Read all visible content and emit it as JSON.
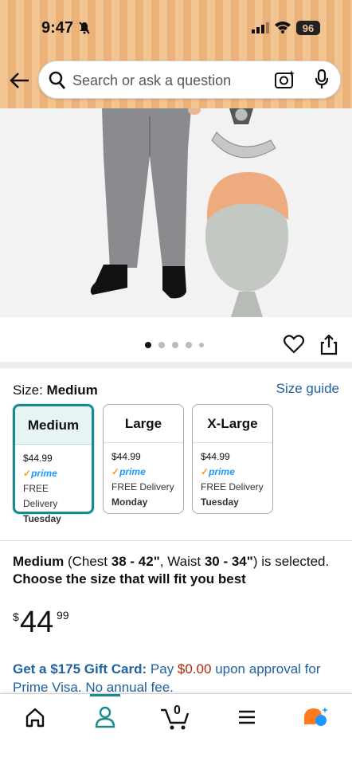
{
  "status": {
    "time": "9:47",
    "battery": "96"
  },
  "search": {
    "placeholder": "Search or ask a question"
  },
  "gallery": {
    "dot_count": 5,
    "active_index": 0
  },
  "size": {
    "label": "Size:",
    "selected": "Medium",
    "guide_link": "Size guide",
    "options": [
      {
        "name": "Medium",
        "price": "$44.99",
        "prime": "prime",
        "delivery": "FREE Delivery",
        "day": "Tuesday"
      },
      {
        "name": "Large",
        "price": "$44.99",
        "prime": "prime",
        "delivery": "FREE Delivery",
        "day": "Monday"
      },
      {
        "name": "X-Large",
        "price": "$44.99",
        "prime": "prime",
        "delivery": "FREE Delivery",
        "day": "Tuesday"
      }
    ]
  },
  "selection_info": {
    "size": "Medium",
    "chest_prefix": " (Chest ",
    "chest": "38 - 42\"",
    "waist_prefix": ", Waist ",
    "waist": "30 - 34\"",
    "suffix": ") is selected.",
    "advice": "Choose the size that will fit you best"
  },
  "price": {
    "symbol": "$",
    "whole": "44",
    "fraction": "99"
  },
  "gift_card": {
    "bold": "Get a $175 Gift Card:",
    "pay": " Pay ",
    "amount": "$0.00",
    "rest": " upon approval for Prime Visa. No annual fee."
  },
  "bottom_nav": {
    "cart_count": "0",
    "items": [
      "home-icon",
      "account-icon",
      "cart-icon",
      "menu-icon",
      "rufus-icon"
    ]
  },
  "colors": {
    "accent": "#1b8a8a",
    "link": "#2162a1",
    "header": "#f2c491",
    "price_red": "#b12704"
  }
}
